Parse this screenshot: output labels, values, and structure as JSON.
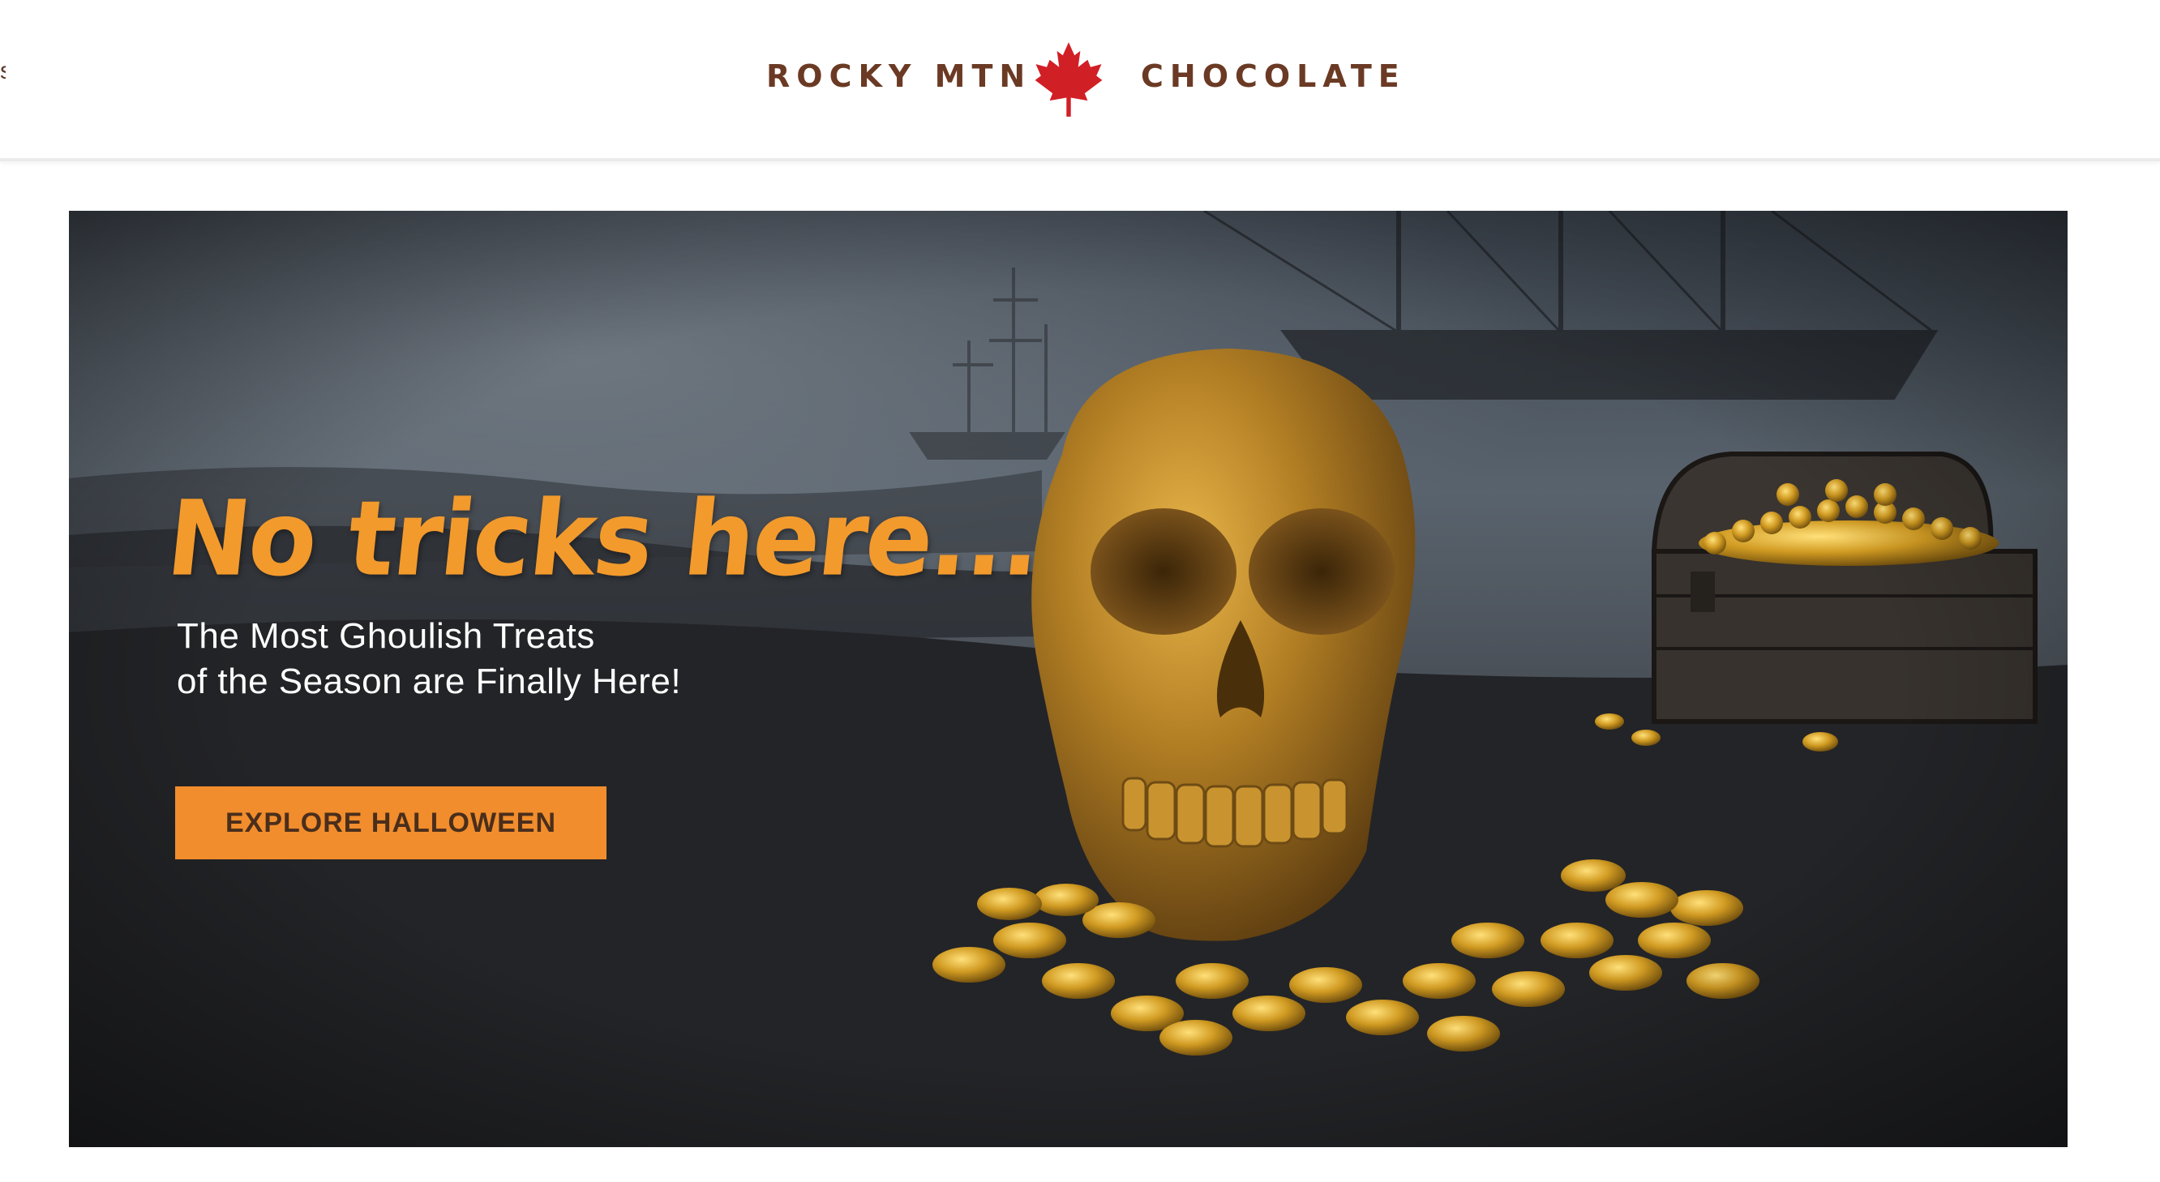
{
  "brand": {
    "left_text": "ROCKY MTN",
    "right_text": "CHOCOLATE",
    "icon": "maple-leaf-icon",
    "text_color": "#6b3a24",
    "leaf_color": "#d11f26"
  },
  "header": {
    "edge_glyph": "s"
  },
  "hero": {
    "headline": "No tricks here...",
    "subline_1": "The Most Ghoulish Treats",
    "subline_2": "of the Season are Finally Here!",
    "cta_label": "EXPLORE HALLOWEEN",
    "headline_color": "#f39a2c",
    "cta_color": "#f18d2c"
  }
}
